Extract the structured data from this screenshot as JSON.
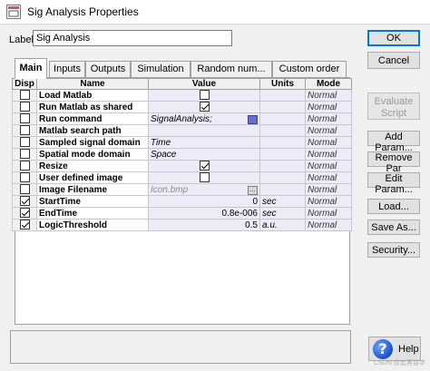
{
  "window": {
    "title": "Sig Analysis Properties",
    "icon": "dialog-app-icon"
  },
  "label_field": {
    "caption": "Label:",
    "value": "Sig Analysis"
  },
  "buttons": {
    "ok": "OK",
    "cancel": "Cancel",
    "evaluate_script": "Evaluate Script",
    "add_param": "Add Param...",
    "remove_param": "Remove Par",
    "edit_param": "Edit Param...",
    "load": "Load...",
    "save_as": "Save As...",
    "security": "Security...",
    "help": "Help"
  },
  "tabs": [
    {
      "label": "Main",
      "active": true
    },
    {
      "label": "Inputs",
      "active": false
    },
    {
      "label": "Outputs",
      "active": false
    },
    {
      "label": "Simulation",
      "active": false
    },
    {
      "label": "Random num...",
      "active": false
    },
    {
      "label": "Custom order",
      "active": false
    }
  ],
  "grid": {
    "headers": [
      "Disp",
      "Name",
      "Value",
      "Units",
      "Mode"
    ],
    "rows": [
      {
        "disp": false,
        "name": "Load Matlab",
        "value": "",
        "value_checkbox": false,
        "units": "",
        "mode": "Normal"
      },
      {
        "disp": false,
        "name": "Run Matlab as shared",
        "value": "",
        "value_checkbox": true,
        "units": "",
        "mode": "Normal"
      },
      {
        "disp": false,
        "name": "Run command",
        "value": "SignalAnalysis;",
        "units": "",
        "mode": "Normal"
      },
      {
        "disp": false,
        "name": "Matlab search path",
        "value": "",
        "units": "",
        "mode": "Normal"
      },
      {
        "disp": false,
        "name": "Sampled signal domain",
        "value": "Time",
        "units": "",
        "mode": "Normal"
      },
      {
        "disp": false,
        "name": "Spatial mode domain",
        "value": "Space",
        "units": "",
        "mode": "Normal"
      },
      {
        "disp": false,
        "name": "Resize",
        "value": "",
        "value_checkbox": true,
        "units": "",
        "mode": "Normal"
      },
      {
        "disp": false,
        "name": "User defined image",
        "value": "",
        "value_checkbox": false,
        "units": "",
        "mode": "Normal"
      },
      {
        "disp": false,
        "name": "Image Filename",
        "value": "Icon.bmp",
        "units": "",
        "mode": "Normal"
      },
      {
        "disp": true,
        "name": "StartTime",
        "value": "0",
        "units": "sec",
        "mode": "Normal"
      },
      {
        "disp": true,
        "name": "EndTime",
        "value": "0.8e-006",
        "units": "sec",
        "mode": "Normal"
      },
      {
        "disp": true,
        "name": "LogicThreshold",
        "value": "0.5",
        "units": "a.u.",
        "mode": "Normal"
      }
    ]
  },
  "watermark": "CSDN @北客谈学"
}
